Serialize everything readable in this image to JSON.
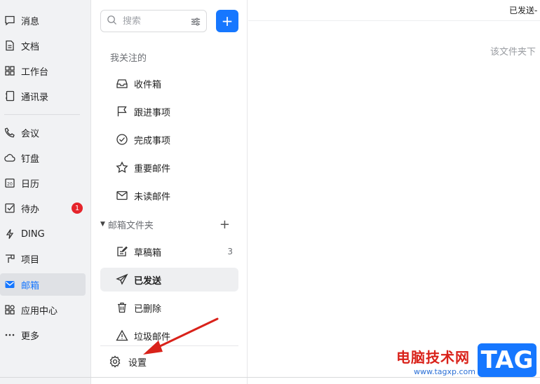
{
  "nav": {
    "items": [
      {
        "label": "消息",
        "icon": "chat-icon"
      },
      {
        "label": "文档",
        "icon": "doc-icon"
      },
      {
        "label": "工作台",
        "icon": "grid-icon"
      },
      {
        "label": "通讯录",
        "icon": "contacts-icon"
      },
      {
        "label": "会议",
        "icon": "phone-icon"
      },
      {
        "label": "钉盘",
        "icon": "cloud-icon"
      },
      {
        "label": "日历",
        "icon": "calendar-icon"
      },
      {
        "label": "待办",
        "icon": "checkbox-icon",
        "badge": "1"
      },
      {
        "label": "DING",
        "icon": "bolt-icon"
      },
      {
        "label": "项目",
        "icon": "project-icon"
      },
      {
        "label": "邮箱",
        "icon": "mail-icon",
        "active": true
      },
      {
        "label": "应用中心",
        "icon": "apps-icon"
      },
      {
        "label": "更多",
        "icon": "more-icon"
      }
    ]
  },
  "search": {
    "placeholder": "搜索"
  },
  "add_button": {
    "label": "+"
  },
  "mailbox": {
    "section_title": "我关注的",
    "followed": [
      {
        "label": "收件箱",
        "icon": "inbox-icon"
      },
      {
        "label": "跟进事项",
        "icon": "flag-icon"
      },
      {
        "label": "完成事项",
        "icon": "check-circle-icon"
      },
      {
        "label": "重要邮件",
        "icon": "star-icon"
      },
      {
        "label": "未读邮件",
        "icon": "envelope-icon"
      }
    ],
    "folders_title": "邮箱文件夹",
    "folders_add": "+",
    "folders": [
      {
        "label": "草稿箱",
        "icon": "draft-icon",
        "count": "3"
      },
      {
        "label": "已发送",
        "icon": "send-icon",
        "active": true
      },
      {
        "label": "已删除",
        "icon": "trash-icon"
      },
      {
        "label": "垃圾邮件",
        "icon": "warning-icon"
      }
    ],
    "settings_label": "设置"
  },
  "content": {
    "title": "已发送-",
    "empty_text": "该文件夹下"
  },
  "watermark": {
    "site_name": "电脑技术网",
    "url": "www.tagxp.com",
    "tag": "TAG"
  },
  "colors": {
    "accent": "#1677ff",
    "badge": "#e5242b",
    "arrow": "#d9221a"
  }
}
